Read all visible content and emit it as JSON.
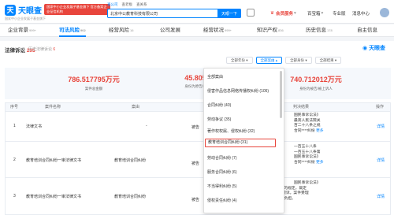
{
  "header": {
    "logo_text": "天眼查",
    "logo_sub": "国家中小企业发展子基金旗下",
    "badge": "国家中小企业发展子基金旗下 官方备案企业征信机构",
    "search_tabs": [
      "查公司",
      "查老板",
      "查关系"
    ],
    "search_value": "北京中公教育科技有限公司",
    "search_button": "天眼一下",
    "nav": {
      "vip": "会员服务",
      "enterprise": "百宝箱",
      "pro": "专业版",
      "messages": "消息中心",
      "user": "我的"
    }
  },
  "tabs": [
    {
      "label": "企业背景",
      "count": "999+"
    },
    {
      "label": "司法风险",
      "count": "902"
    },
    {
      "label": "经营风险",
      "count": "16"
    },
    {
      "label": "公司发展",
      "count": ""
    },
    {
      "label": "经营状况",
      "count": "999+"
    },
    {
      "label": "知识产权",
      "count": "836"
    },
    {
      "label": "历史信息",
      "count": "178"
    },
    {
      "label": "自主信息",
      "count": ""
    }
  ],
  "section": {
    "title": "法律诉讼",
    "count": "295",
    "history_label": "历史法律诉讼",
    "history_count": "6",
    "brand": "天眼查"
  },
  "filters": {
    "year": "全部年份",
    "case_type": "全部案由",
    "identity": "全部身份",
    "result": "全部结果"
  },
  "stats": [
    {
      "value": "786.517795万元",
      "label": "案件总金额"
    },
    {
      "value": "45.80578",
      "label": "身份为原告/上诉人"
    },
    {
      "value": "740.712012万元",
      "label": "身份为被告/被上诉人"
    }
  ],
  "table": {
    "columns": [
      "序号",
      "案件名称",
      "案由",
      "判决结果",
      "操作"
    ],
    "rows": [
      {
        "no": "1",
        "name": "法律文书",
        "cause": "-",
        "role": "被告",
        "result_lines": [
          "国民事诉讼法》",
          "最高人民法院关",
          "百二十八条之规",
          "合同****纠纷"
        ],
        "action": "详情"
      },
      {
        "no": "2",
        "name": "教育培训合同纠纷一审法律文书",
        "cause": "教育培训合同纠纷",
        "role": "被告",
        "result_lines": [
          "一百五十八条",
          "一百五十八条第",
          "国民事诉讼法》",
          "合同****纠纷"
        ],
        "action": "详情"
      },
      {
        "no": "3",
        "name": "教育培训合同纠纷一审法律文书",
        "cause": "教育培训合同纠纷",
        "role": "被告",
        "result_lines": [
          "国民事诉讼法》",
          "第一百四十条第一款的规定，裁定",
          "如下：准许原告****撤诉。案件受理",
          "费404.67元，由原告负担。"
        ],
        "action": "详情"
      }
    ],
    "more_label": "更多"
  },
  "dropdown": {
    "items": [
      "全部案由",
      "侵害作品信息网络传播权纠纷 (105)",
      "合同纠纷 (40)",
      "劳动争议 (35)",
      "著作权权属、侵权纠纷 (32)",
      "教育培训合同纠纷 (31)",
      "劳动合同纠纷 (7)",
      "服务合同纠纷 (6)",
      "不当得利纠纷 (5)",
      "侵权责任纠纷 (4)"
    ],
    "highlighted_index": 5
  }
}
